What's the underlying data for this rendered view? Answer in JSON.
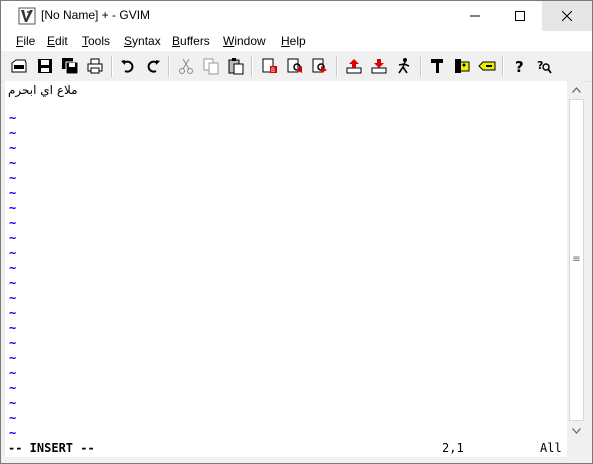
{
  "window": {
    "title": "[No Name] + - GVIM",
    "icon": "gvim-icon",
    "controls": [
      "minimize-icon",
      "maximize-icon",
      "close-icon"
    ]
  },
  "menubar": {
    "items": [
      {
        "label_ul": "F",
        "label_rest": "ile"
      },
      {
        "label_ul": "E",
        "label_rest": "dit"
      },
      {
        "label_ul": "T",
        "label_rest": "ools"
      },
      {
        "label_ul": "S",
        "label_rest": "yntax"
      },
      {
        "label_ul": "B",
        "label_rest": "uffers"
      },
      {
        "label_ul": "W",
        "label_rest": "indow"
      },
      {
        "label_ul": "H",
        "label_rest": "elp"
      }
    ]
  },
  "toolbar": {
    "icons": [
      "open-icon",
      "save-icon",
      "save-all-icon",
      "print-icon",
      "undo-icon",
      "redo-icon",
      "cut-icon",
      "copy-icon",
      "paste-icon",
      "replace-icon",
      "find-next-icon",
      "find-prev-icon",
      "load-session-icon",
      "save-session-icon",
      "run-script-icon",
      "make-icon",
      "shell-icon",
      "ctags-icon",
      "help-icon",
      "find-help-icon"
    ]
  },
  "editor": {
    "line1": "ملاع اي ابحرم",
    "tilde": "~"
  },
  "statusline": {
    "mode": "-- INSERT --",
    "position": "2,1",
    "scroll": "All"
  }
}
